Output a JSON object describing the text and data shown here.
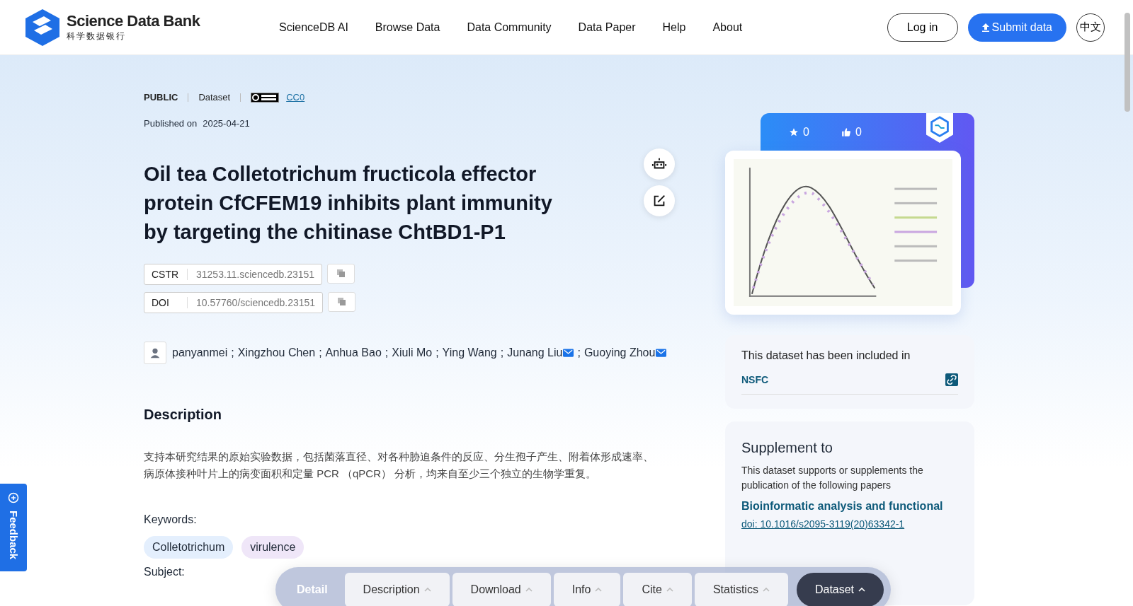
{
  "header": {
    "brand": "Science Data Bank",
    "brand_sub": "科学数据银行",
    "nav": [
      {
        "label": "ScienceDB AI"
      },
      {
        "label": "Browse Data"
      },
      {
        "label": "Data Community"
      },
      {
        "label": "Data Paper"
      },
      {
        "label": "Help"
      },
      {
        "label": "About"
      }
    ],
    "login": "Log in",
    "submit": "Submit data",
    "lang": "中文"
  },
  "meta": {
    "access": "PUBLIC",
    "type": "Dataset",
    "license": "CC0",
    "published_label": "Published on",
    "published_date": "2025-04-21"
  },
  "title": "Oil tea Colletotrichum fructicola effector protein CfCFEM19 inhibits plant immunity by targeting the chitinase ChtBD1-P1",
  "identifiers": [
    {
      "label": "CSTR",
      "value": "31253.11.sciencedb.23151"
    },
    {
      "label": "DOI",
      "value": "10.57760/sciencedb.23151"
    }
  ],
  "author_separator": ";",
  "authors": [
    {
      "name": "panyanmei",
      "email": false
    },
    {
      "name": "Xingzhou Chen",
      "email": false
    },
    {
      "name": "Anhua Bao",
      "email": false
    },
    {
      "name": "Xiuli Mo",
      "email": false
    },
    {
      "name": "Ying Wang",
      "email": false
    },
    {
      "name": "Junang Liu",
      "email": true
    },
    {
      "name": "Guoying Zhou",
      "email": true
    }
  ],
  "description": {
    "heading": "Description",
    "text": "支持本研究结果的原始实验数据，包括菌落直径、对各种胁迫条件的反应、分生孢子产生、附着体形成速率、病原体接种叶片上的病变面积和定量 PCR （qPCR） 分析，均来自至少三个独立的生物学重复。"
  },
  "keywords": {
    "label": "Keywords:",
    "items": [
      {
        "text": "Colletotrichum",
        "color": "#e4effd"
      },
      {
        "text": "virulence",
        "color": "#efe6f8"
      }
    ]
  },
  "subject_label": "Subject:",
  "stats": {
    "stars": "0",
    "likes": "0"
  },
  "included": {
    "heading": "This dataset has been included in",
    "items": [
      {
        "name": "NSFC"
      }
    ]
  },
  "supplement": {
    "heading": "Supplement to",
    "text": "This dataset supports or supplements the publication of the following papers",
    "paper_title": "Bioinformatic analysis and functional",
    "paper_doi": "doi: 10.1016/s2095-3119(20)63342-1"
  },
  "detail_bar": {
    "label": "Detail",
    "tabs": [
      {
        "label": "Description",
        "selected": false
      },
      {
        "label": "Download",
        "selected": false
      },
      {
        "label": "Info",
        "selected": false
      },
      {
        "label": "Cite",
        "selected": false
      },
      {
        "label": "Statistics",
        "selected": false
      },
      {
        "label": "Dataset",
        "selected": true
      }
    ]
  },
  "feedback": "Feedback"
}
